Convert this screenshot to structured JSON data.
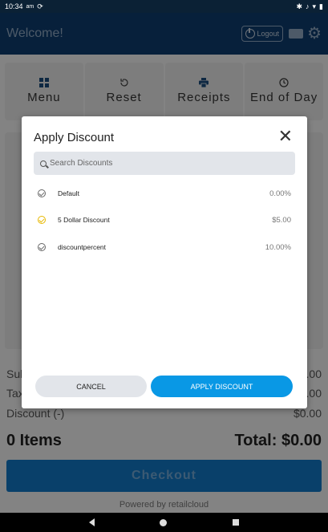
{
  "status_bar": {
    "time": "10:34",
    "ampm": "am"
  },
  "header": {
    "welcome": "Welcome!",
    "logout_label": "Logout"
  },
  "toolbar": [
    {
      "label": "Menu",
      "icon": "grid-icon"
    },
    {
      "label": "Reset",
      "icon": "undo-icon"
    },
    {
      "label": "Receipts",
      "icon": "printer-icon"
    },
    {
      "label": "End of Day",
      "icon": "clock-icon"
    }
  ],
  "summary": {
    "subtotal_label": "Sul",
    "subtotal_value": ".00",
    "tax_label": "Tax",
    "tax_value": ".00",
    "discount_label": "Discount (-)",
    "discount_value": "$0.00",
    "items": "0 Items",
    "total": "Total: $0.00"
  },
  "checkout_label": "Checkout",
  "powered_by": "Powered by retailcloud",
  "modal": {
    "title": "Apply Discount",
    "search_placeholder": "Search Discounts",
    "discounts": [
      {
        "name": "Default",
        "amount": "0.00%",
        "selected": false
      },
      {
        "name": "5 Dollar Discount",
        "amount": "$5.00",
        "selected": true
      },
      {
        "name": "discountpercent",
        "amount": "10.00%",
        "selected": false
      }
    ],
    "cancel_label": "CANCEL",
    "apply_label": "APPLY DISCOUNT"
  },
  "colors": {
    "header": "#0d3c6e",
    "primary": "#0998e5",
    "selected_check": "#e7b800"
  }
}
